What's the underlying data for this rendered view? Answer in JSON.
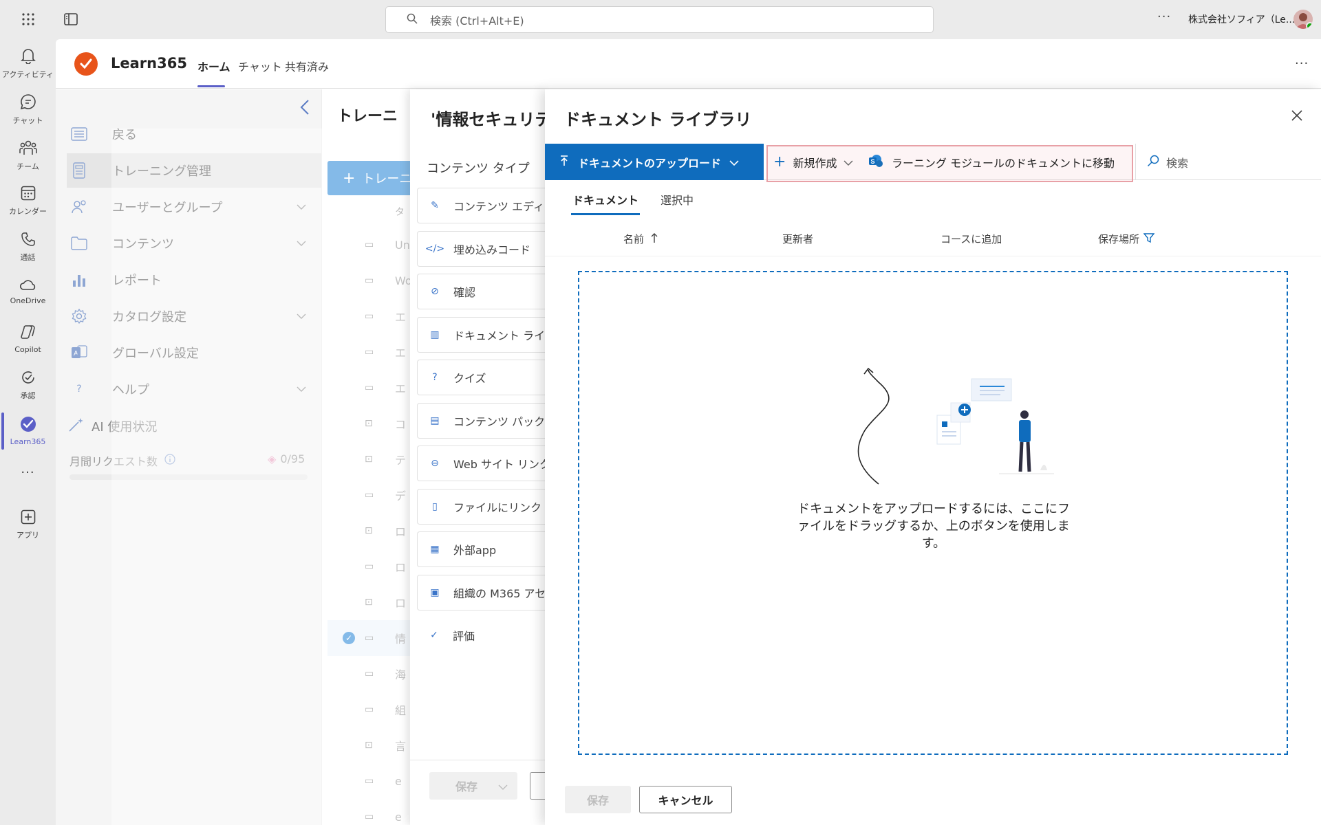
{
  "topbar": {
    "search_placeholder": "検索 (Ctrl+Alt+E)",
    "org_name": "株式会社ソフィア（Le...",
    "more": "···"
  },
  "rail": {
    "items": [
      {
        "label": "アクティビティ",
        "icon": "bell-icon"
      },
      {
        "label": "チャット",
        "icon": "chat-icon"
      },
      {
        "label": "チーム",
        "icon": "teams-icon"
      },
      {
        "label": "カレンダー",
        "icon": "calendar-icon"
      },
      {
        "label": "通話",
        "icon": "phone-icon"
      },
      {
        "label": "OneDrive",
        "icon": "cloud-icon"
      },
      {
        "label": "Copilot",
        "icon": "copilot-icon"
      },
      {
        "label": "承認",
        "icon": "approval-icon"
      },
      {
        "label": "Learn365",
        "icon": "learn365-icon"
      },
      {
        "label": "アプリ",
        "icon": "add-app-icon"
      }
    ],
    "more": "···"
  },
  "app": {
    "name": "Learn365",
    "tabs": [
      "ホーム",
      "チャット",
      "共有済み"
    ],
    "more": "···"
  },
  "sidenav": {
    "items": [
      {
        "label": "戻る",
        "icon": "back-list-icon"
      },
      {
        "label": "トレーニング管理",
        "icon": "training-icon"
      },
      {
        "label": "ユーザーとグループ",
        "icon": "users-icon"
      },
      {
        "label": "コンテンツ",
        "icon": "folder-icon"
      },
      {
        "label": "レポート",
        "icon": "chart-icon"
      },
      {
        "label": "カタログ設定",
        "icon": "settings-icon"
      },
      {
        "label": "グローバル設定",
        "icon": "global-icon"
      },
      {
        "label": "ヘルプ",
        "icon": "help-icon"
      }
    ],
    "ai_usage": "AI 使用状況",
    "monthly_requests": "月間リクエスト数",
    "request_count": "0/95"
  },
  "midlist": {
    "heading": "トレーニ",
    "add_button": "トレーニ",
    "column": "タ",
    "rows": [
      "Un",
      "Wo",
      "エ",
      "エ",
      "エ",
      "コ",
      "テ",
      "デ",
      "ロ",
      "ロ",
      "ロ",
      "情",
      "海",
      "組",
      "言",
      "e",
      "e"
    ]
  },
  "panel1": {
    "title": "'情報セキュリテ",
    "subtitle": "コンテンツ タイプ",
    "items": [
      {
        "label": "コンテンツ エディ",
        "icon": "edit-icon"
      },
      {
        "label": "埋め込みコード",
        "icon": "code-icon"
      },
      {
        "label": "確認",
        "icon": "checklist-icon"
      },
      {
        "label": "ドキュメント ライ",
        "icon": "library-icon"
      },
      {
        "label": "クイズ",
        "icon": "question-icon"
      },
      {
        "label": "コンテンツ パック",
        "icon": "package-icon"
      },
      {
        "label": "Web サイト リンク",
        "icon": "link-icon"
      },
      {
        "label": "ファイルにリンク",
        "icon": "file-link-icon"
      },
      {
        "label": "外部app",
        "icon": "app-grid-icon"
      },
      {
        "label": "組織の M365 アセ",
        "icon": "org-folder-icon"
      },
      {
        "label": "評価",
        "icon": "checkmark-icon"
      }
    ],
    "save": "保存"
  },
  "panel2": {
    "title": "ドキュメント ライブラリ",
    "upload": "ドキュメントのアップロード",
    "new": "新規作成",
    "goto": "ラーニング モジュールのドキュメントに移動",
    "search_placeholder": "検索",
    "tabs": [
      "ドキュメント",
      "選択中"
    ],
    "columns": [
      "名前",
      "更新者",
      "コースに追加",
      "保存場所"
    ],
    "dropzone_message": "ドキュメントをアップロードするには、ここにファイルをドラッグするか、上のボタンを使用します。",
    "save": "保存",
    "cancel": "キャンセル",
    "colors": {
      "primary": "#0f6cbd",
      "highlight": "#e8a0a6"
    }
  }
}
